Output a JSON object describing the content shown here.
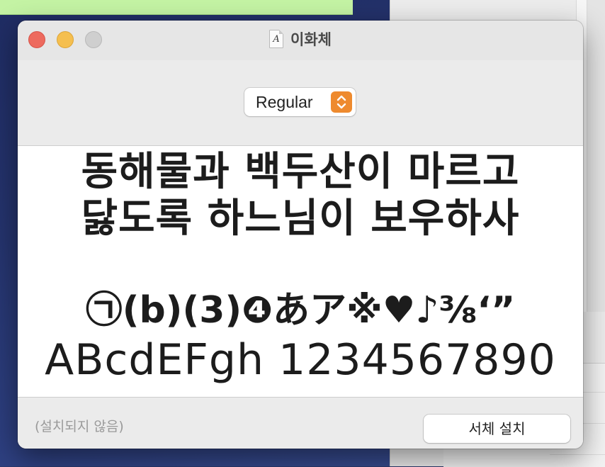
{
  "window": {
    "title": "이화체",
    "doc_icon_glyph": "A"
  },
  "toolbar": {
    "style_select": {
      "selected": "Regular",
      "accent_color": "#ee8a2e"
    }
  },
  "preview": {
    "lines": [
      "동해물과 백두산이 마르고",
      "닳도록 하느님이 보우하사",
      "㉠(b)(3)❹あア※♥♪⅜‘”",
      "ABcdEFgh 1234567890"
    ]
  },
  "footer": {
    "status": "(설치되지 않음)",
    "install_label": "서체 설치"
  },
  "colors": {
    "close": "#ed6a5e",
    "minimize": "#f5bf4f",
    "zoom": "#cfcfcf"
  }
}
